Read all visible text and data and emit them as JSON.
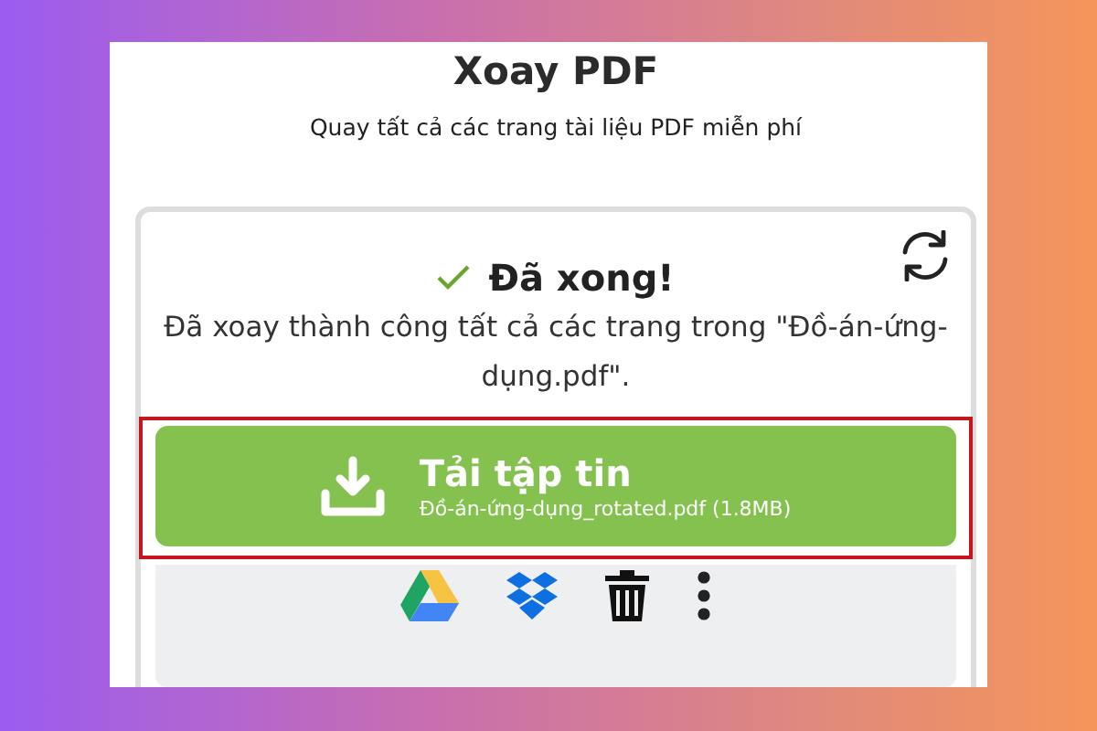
{
  "page": {
    "title": "Xoay PDF",
    "subtitle": "Quay tất cả các trang tài liệu PDF miễn phí"
  },
  "result": {
    "status": "Đã xong!",
    "message": "Đã xoay thành công tất cả các trang trong \"Đồ-án-ứng-dụng.pdf\".",
    "download": {
      "label": "Tải tập tin",
      "file": "Đồ-án-ứng-dụng_rotated.pdf (1.8MB)",
      "highlighted": true
    },
    "actions": [
      {
        "kind": "drive"
      },
      {
        "kind": "dropbox"
      },
      {
        "kind": "delete"
      },
      {
        "kind": "more"
      }
    ]
  }
}
